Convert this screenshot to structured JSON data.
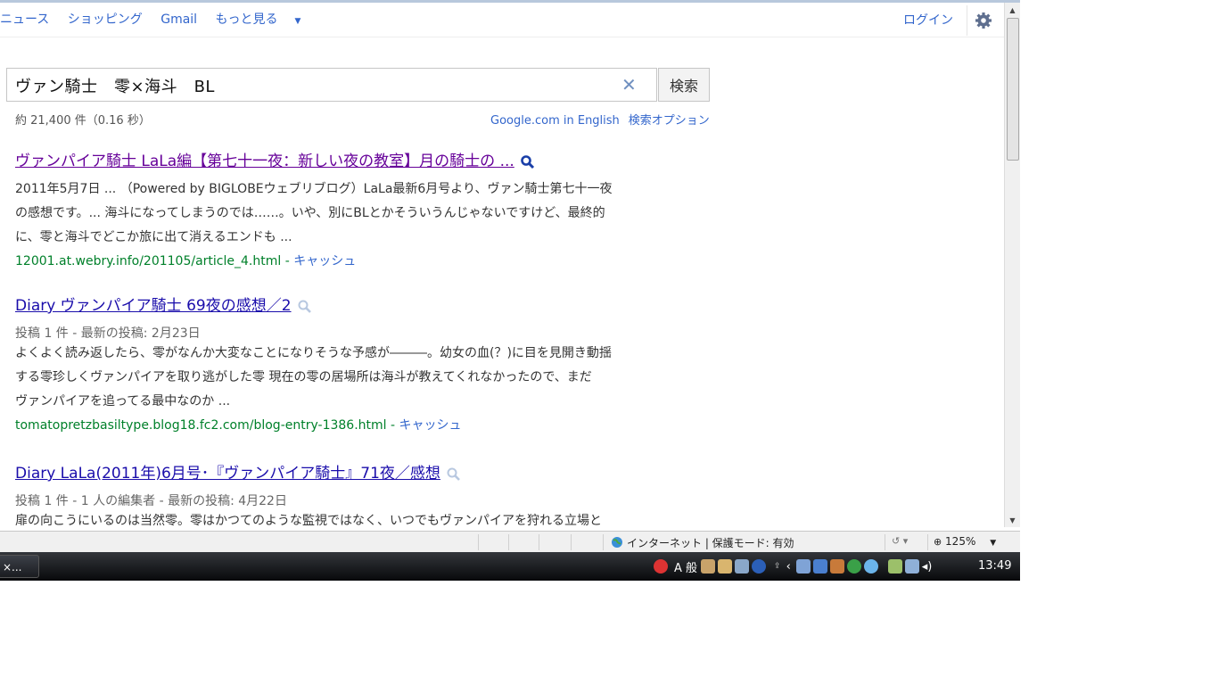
{
  "gbar": {
    "nav": [
      "ニュース",
      "ショッピング",
      "Gmail",
      "もっと見る"
    ],
    "login": "ログイン"
  },
  "search": {
    "query": "ヴァン騎士　零×海斗　BL",
    "button": "検索"
  },
  "stats": "約 21,400 件（0.16 秒）",
  "tools": {
    "english": "Google.com in English",
    "options": "検索オプション"
  },
  "results": [
    {
      "title": "ヴァンパイア騎士 LaLa編【第七十一夜：新しい夜の教室】月の騎士の ...",
      "snippet_lines": [
        "2011年5月7日 ... （Powered by BIGLOBEウェブリブログ）LaLa最新6月号より、ヴァン騎士第七十一夜",
        "の感想です。... 海斗になってしまうのでは……。いや、別にBLとかそういうんじゃないですけど、最終的",
        "に、零と海斗でどこか旅に出て消えるエンドも ..."
      ],
      "url": "12001.at.webry.info/201105/article_4.html",
      "cache": "キャッシュ"
    },
    {
      "title": "Diary ヴァンパイア騎士 69夜の感想／2",
      "meta": "投稿 1 件 - 最新の投稿: 2月23日",
      "snippet_lines": [
        "よくよく読み返したら、零がなんか大変なことになりそうな予感が―――。幼女の血(？)に目を見開き動揺",
        "する零珍しくヴァンパイアを取り逃がした零 現在の零の居場所は海斗が教えてくれなかったので、まだ",
        "ヴァンパイアを追ってる最中なのか ..."
      ],
      "url": "tomatopretzbasiltype.blog18.fc2.com/blog-entry-1386.html",
      "cache": "キャッシュ"
    },
    {
      "title": "Diary LaLa(2011年)6月号･『ヴァンパイア騎士』71夜／感想",
      "meta": "投稿 1 件 - 1 人の編集者 - 最新の投稿: 4月22日",
      "snippet_lines": [
        "扉の向こうにいるのは当然零。零はかつてのような監視ではなく、いつでもヴァンパイアを狩れる立場と"
      ]
    }
  ],
  "statusbar": {
    "zone": "インターネット | 保護モード: 有効",
    "zoom": "125%"
  },
  "taskbar": {
    "window_button": "×...",
    "ime": "A 般",
    "clock": "13:49"
  },
  "colors": {
    "link": "#1a0dab",
    "visited": "#660099",
    "url_green": "#00802a",
    "nav_blue": "#3366cc"
  }
}
